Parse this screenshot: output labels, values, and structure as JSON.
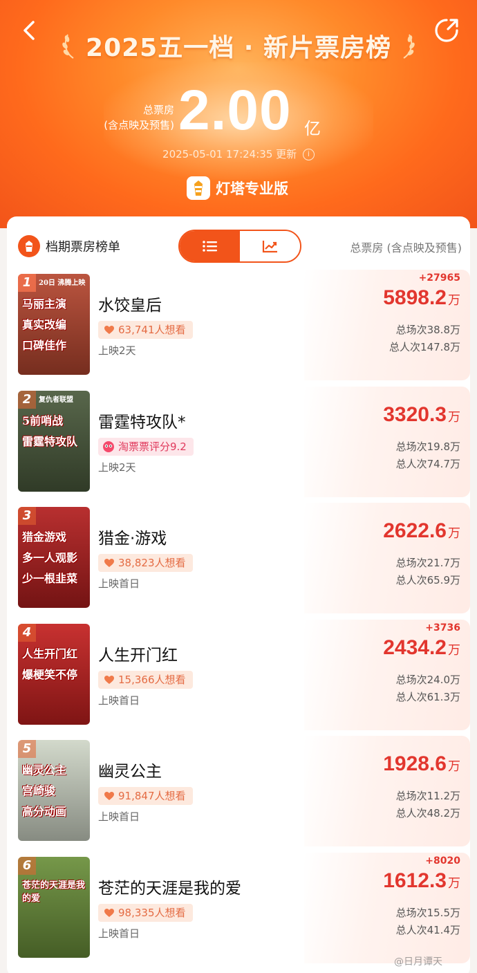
{
  "header": {
    "title": "2025五一档 · 新片票房榜",
    "total_label_line1": "总票房",
    "total_label_line2": "(含点映及预售)",
    "total_value": "2.00",
    "total_unit": "亿",
    "updated_time": "2025-05-01 17:24:35",
    "updated_suffix": "更新",
    "brand": "灯塔专业版"
  },
  "card": {
    "title": "档期票房榜单",
    "column_label": "总票房 (含点映及预售)",
    "view_modes": [
      "list",
      "chart"
    ],
    "active_view": "list"
  },
  "movies": [
    {
      "rank": "1",
      "title": "水饺皇后",
      "tag_type": "want",
      "tag": "63,741人想看",
      "release": "上映2天",
      "change": "+27965",
      "box": "5898.2",
      "unit": "万",
      "sessions": "总场次38.8万",
      "admissions": "总人次147.8万"
    },
    {
      "rank": "2",
      "title": "雷霆特攻队*",
      "tag_type": "rating",
      "tag": "淘票票评分9.2",
      "release": "上映2天",
      "change": "",
      "box": "3320.3",
      "unit": "万",
      "sessions": "总场次19.8万",
      "admissions": "总人次74.7万"
    },
    {
      "rank": "3",
      "title": "猎金·游戏",
      "tag_type": "want",
      "tag": "38,823人想看",
      "release": "上映首日",
      "change": "",
      "box": "2622.6",
      "unit": "万",
      "sessions": "总场次21.7万",
      "admissions": "总人次65.9万"
    },
    {
      "rank": "4",
      "title": "人生开门红",
      "tag_type": "want",
      "tag": "15,366人想看",
      "release": "上映首日",
      "change": "+3736",
      "box": "2434.2",
      "unit": "万",
      "sessions": "总场次24.0万",
      "admissions": "总人次61.3万"
    },
    {
      "rank": "5",
      "title": "幽灵公主",
      "tag_type": "want",
      "tag": "91,847人想看",
      "release": "上映首日",
      "change": "",
      "box": "1928.6",
      "unit": "万",
      "sessions": "总场次11.2万",
      "admissions": "总人次48.2万"
    },
    {
      "rank": "6",
      "title": "苍茫的天涯是我的爱",
      "tag_type": "want",
      "tag": "98,335人想看",
      "release": "上映首日",
      "change": "+8020",
      "box": "1612.3",
      "unit": "万",
      "sessions": "总场次15.5万",
      "admissions": "总人次41.4万"
    }
  ],
  "posters": [
    {
      "lines": [
        "马丽主演",
        "真实改编",
        "口碑佳作"
      ],
      "bg": "#b5462f",
      "top": "20日 沸腾上映"
    },
    {
      "lines": [
        "5前哨战",
        "雷霆特攻队"
      ],
      "bg": "#4a5a3c",
      "top": "复仇者联盟"
    },
    {
      "lines": [
        "猎金游戏",
        "多一人观影",
        "少一根韭菜"
      ],
      "bg": "#b21e1e",
      "top": ""
    },
    {
      "lines": [
        "人生开门红",
        "爆梗笑不停"
      ],
      "bg": "#c3201f",
      "top": ""
    },
    {
      "lines": [
        "幽灵公主",
        "宫崎骏",
        "高分动画"
      ],
      "bg": "#cfd6c7",
      "top": ""
    },
    {
      "lines": [
        "苍茫的天涯是我的爱"
      ],
      "bg": "#6a8f3a",
      "top": ""
    }
  ],
  "watermark": "@日月谭天",
  "colors": {
    "accent": "#f2541a",
    "box_red": "#e2362e",
    "want_bg": "#fde9de",
    "rating_bg": "#fde6ea"
  },
  "icons": {
    "back": "chevron-left-icon",
    "share": "share-icon",
    "info": "info-icon",
    "list": "list-icon",
    "chart": "trend-chart-icon",
    "heart": "heart-icon"
  }
}
